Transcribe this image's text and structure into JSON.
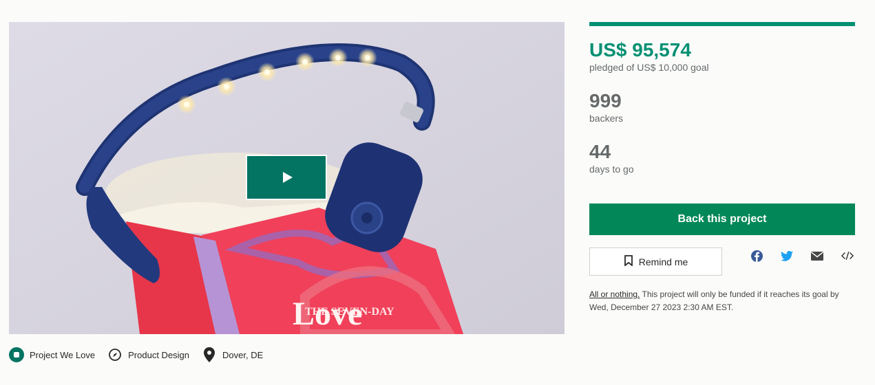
{
  "media": {
    "book_cover_text_top": "THE SEVEN-DAY",
    "book_cover_text_main": "Love",
    "book_spine_text": "THE SEVEN DAY"
  },
  "tags": [
    {
      "label": "Project We Love",
      "icon": "kickstarter-badge-icon"
    },
    {
      "label": "Product Design",
      "icon": "compass-icon"
    },
    {
      "label": "Dover, DE",
      "icon": "location-pin-icon"
    }
  ],
  "campaign": {
    "pledged": "US$ 95,574",
    "goal_text": "pledged of US$ 10,000 goal",
    "backers_count": "999",
    "backers_label": "backers",
    "days_count": "44",
    "days_label": "days to go",
    "funding_progress": 1.0,
    "back_label": "Back this project",
    "remind_label": "Remind me",
    "share_icons": [
      "facebook-icon",
      "twitter-icon",
      "email-icon",
      "embed-icon"
    ],
    "note_link": "All or nothing.",
    "note_text": " This project will only be funded if it reaches its goal by Wed, December 27 2023 2:30 AM EST."
  },
  "colors": {
    "brand_green": "#039073",
    "button_green": "#028858",
    "play_button": "#037362"
  }
}
